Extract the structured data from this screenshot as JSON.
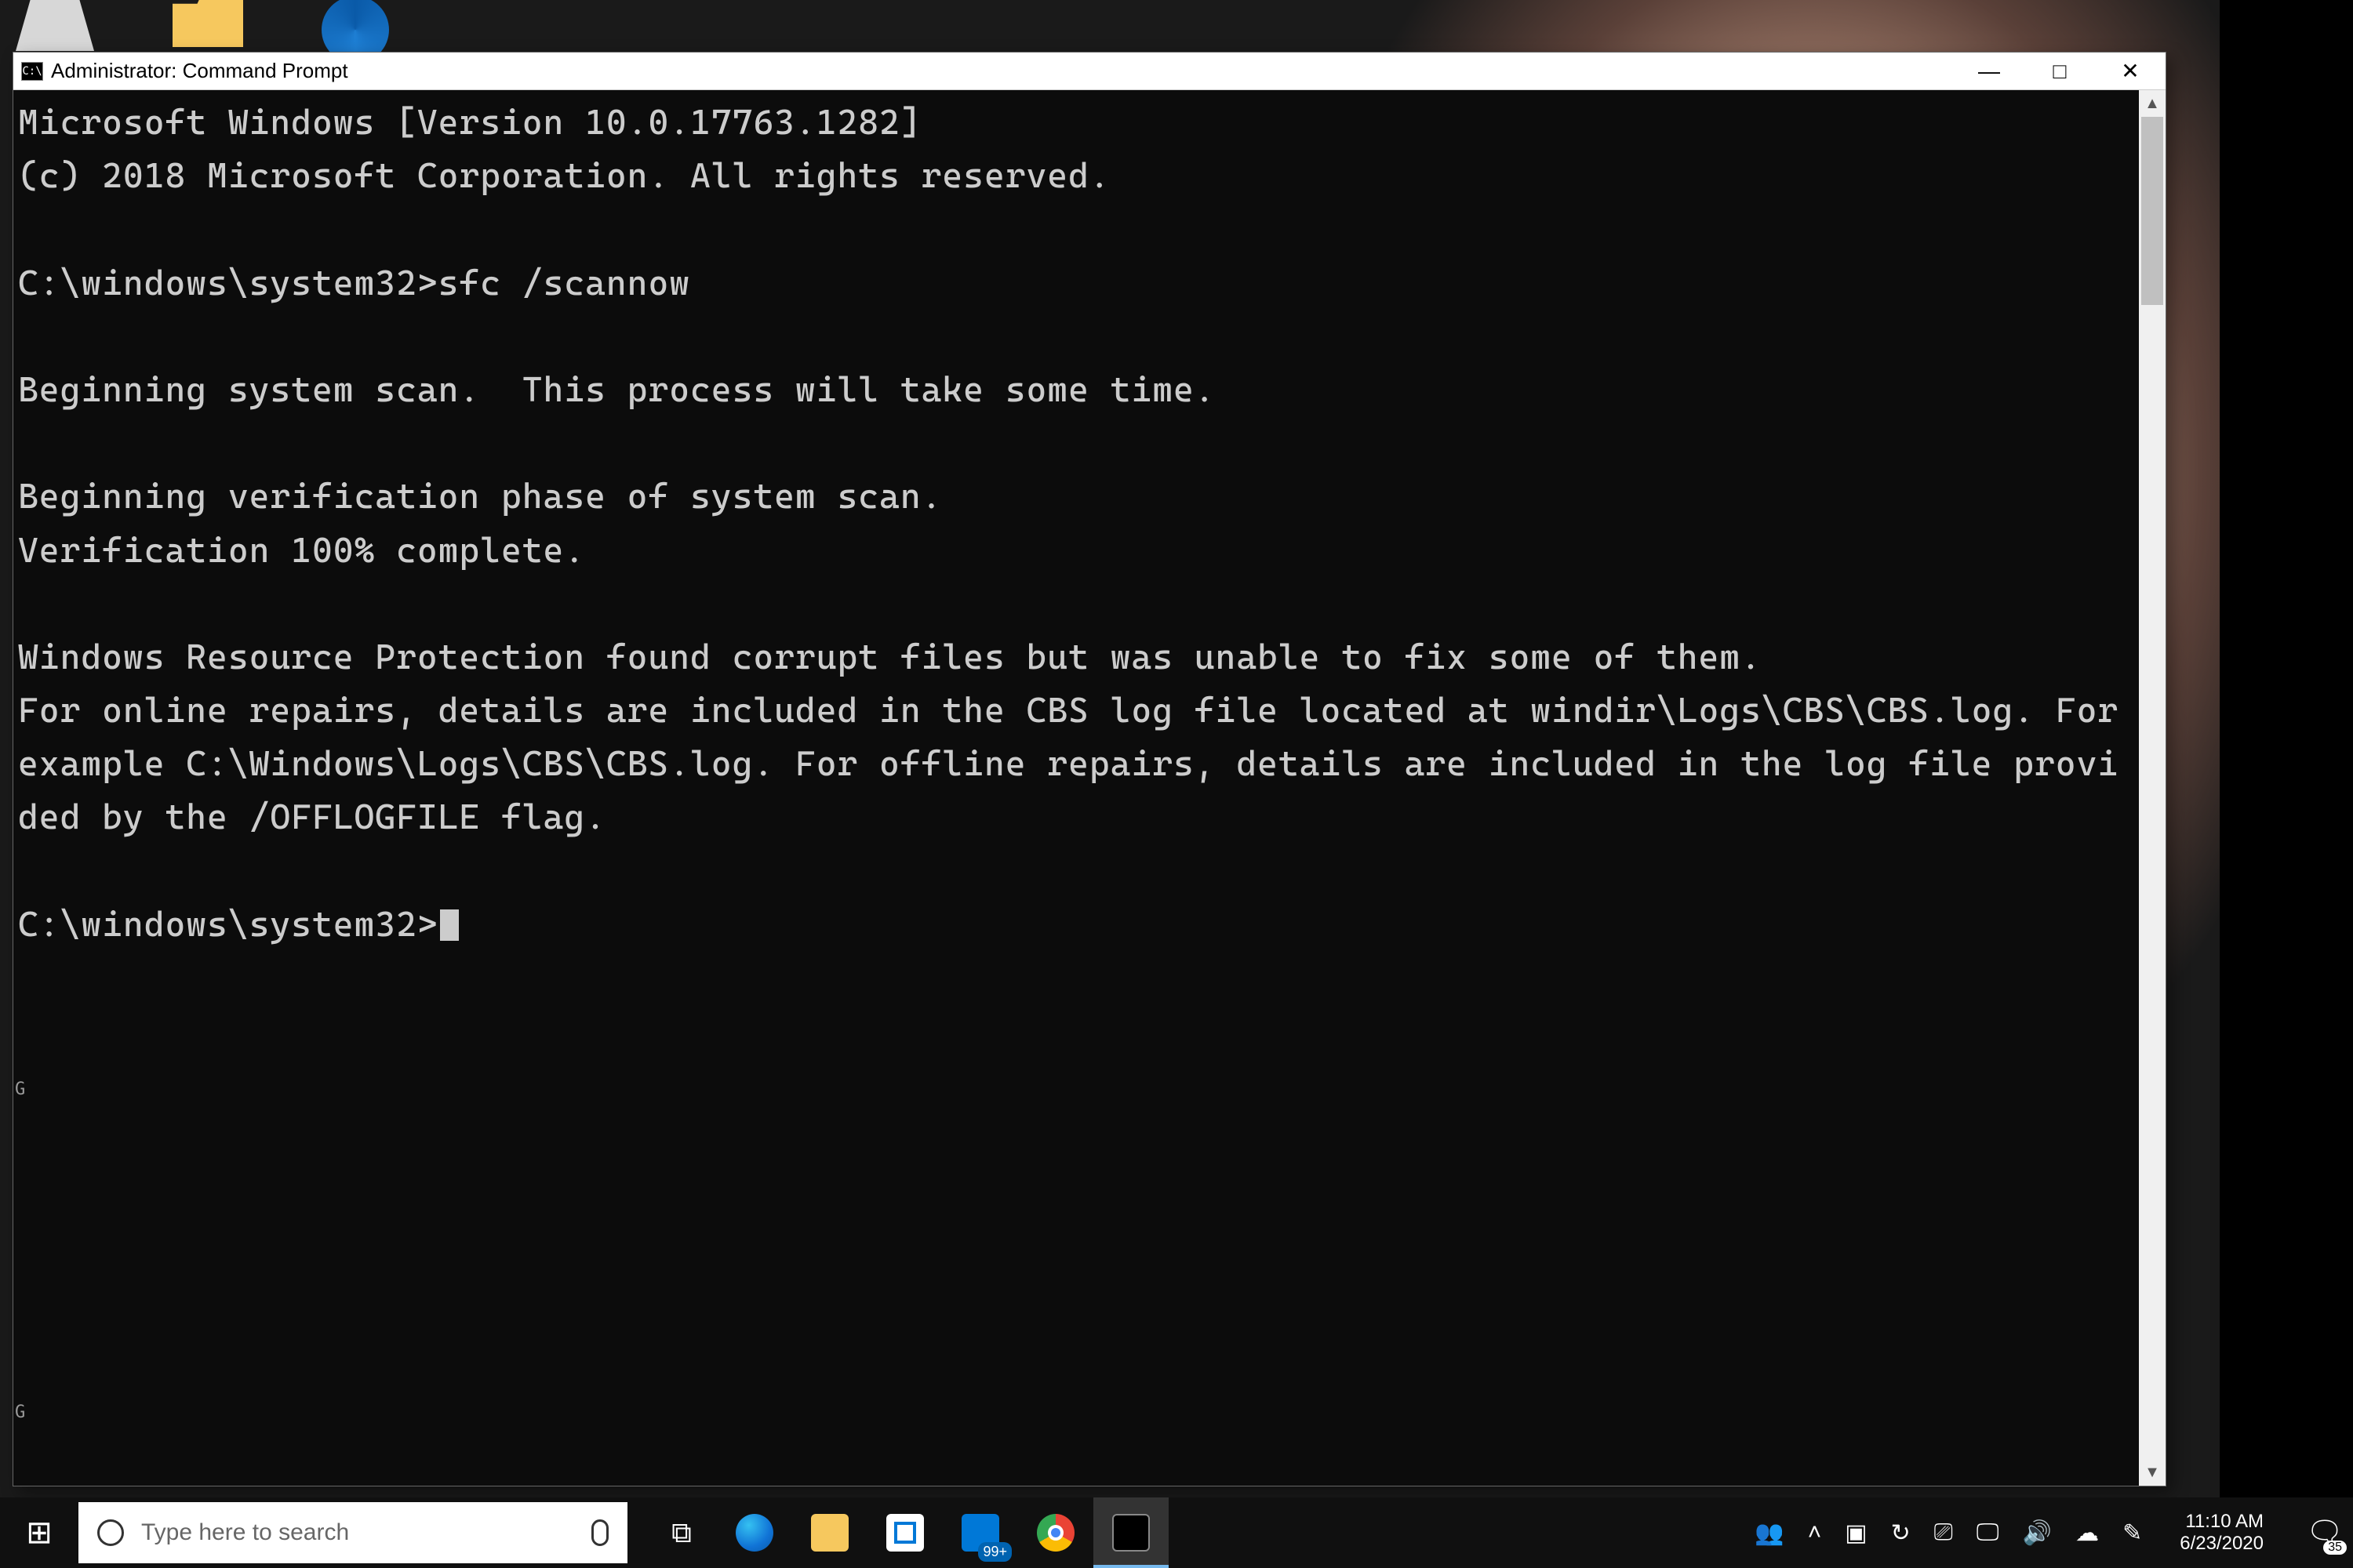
{
  "window": {
    "title": "Administrator: Command Prompt",
    "icon_text": "C:\\",
    "buttons": {
      "min": "—",
      "max": "□",
      "close": "✕"
    }
  },
  "terminal": {
    "lines": [
      "Microsoft Windows [Version 10.0.17763.1282]",
      "(c) 2018 Microsoft Corporation. All rights reserved.",
      "",
      "C:\\windows\\system32>sfc /scannow",
      "",
      "Beginning system scan.  This process will take some time.",
      "",
      "Beginning verification phase of system scan.",
      "Verification 100% complete.",
      "",
      "Windows Resource Protection found corrupt files but was unable to fix some of them.",
      "For online repairs, details are included in the CBS log file located at windir\\Logs\\CBS\\CBS.log. For example C:\\Windows\\Logs\\CBS\\CBS.log. For offline repairs, details are included in the log file provided by the /OFFLOGFILE flag.",
      ""
    ],
    "prompt": "C:\\windows\\system32>"
  },
  "scroll": {
    "up": "▲",
    "down": "▼"
  },
  "stray": {
    "g1": "G",
    "g2": "G"
  },
  "taskbar": {
    "start": "⊞",
    "search_placeholder": "Type here to search",
    "task_view": "⧉",
    "mail_badge": "99+",
    "tray": {
      "people": "👥",
      "chevron": "˄",
      "battery": "▣",
      "sync": "↻",
      "screen1": "⎚",
      "screen2": "🖵",
      "vol": "🔊",
      "cloud": "☁",
      "pen": "✎"
    },
    "clock": {
      "time": "11:10 AM",
      "date": "6/23/2020"
    },
    "notif_glyph": "🗨",
    "notif_count": "35"
  }
}
